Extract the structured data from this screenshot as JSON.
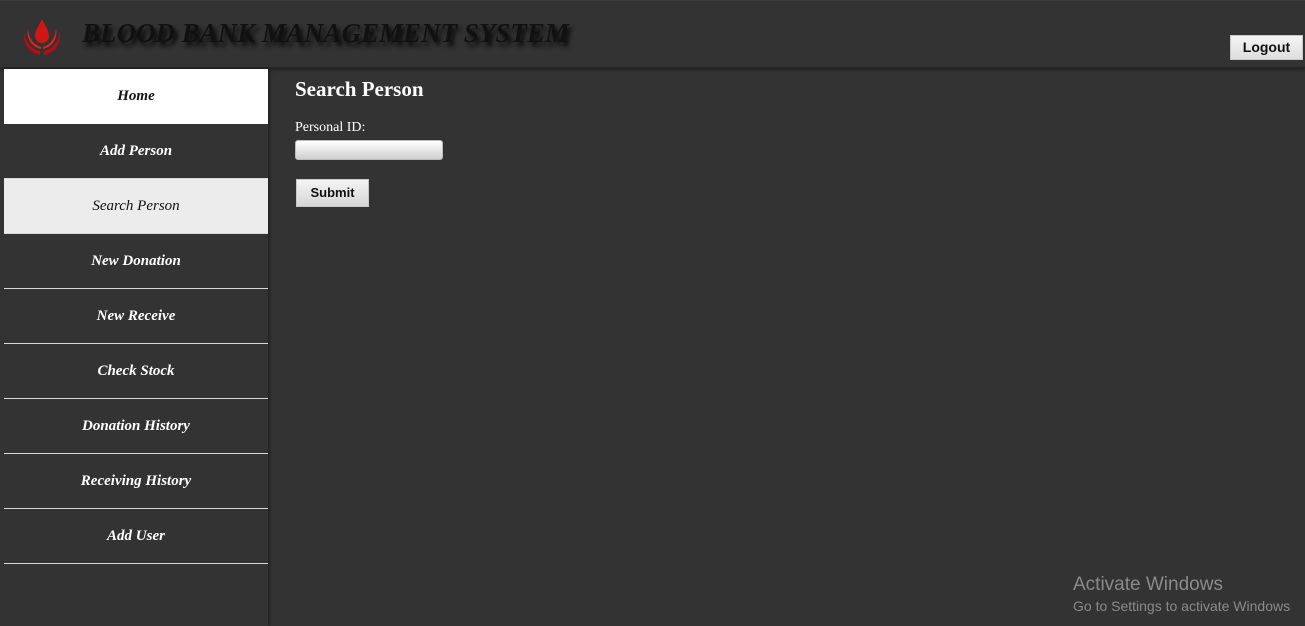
{
  "header": {
    "title": "BLOOD BANK MANAGEMENT SYSTEM",
    "logo_icon": "blood-drop-hands-icon",
    "logout_label": "Logout"
  },
  "sidebar": {
    "items": [
      {
        "label": "Home",
        "state": "home"
      },
      {
        "label": "Add Person",
        "state": "normal"
      },
      {
        "label": "Search Person",
        "state": "active"
      },
      {
        "label": "New Donation",
        "state": "normal"
      },
      {
        "label": "New Receive",
        "state": "normal"
      },
      {
        "label": "Check Stock",
        "state": "normal"
      },
      {
        "label": "Donation History",
        "state": "normal"
      },
      {
        "label": "Receiving History",
        "state": "normal"
      },
      {
        "label": "Add User",
        "state": "normal"
      }
    ]
  },
  "main": {
    "title": "Search Person",
    "form": {
      "personal_id_label": "Personal ID:",
      "personal_id_value": "",
      "submit_label": "Submit"
    }
  },
  "watermark": {
    "title": "Activate Windows",
    "subtitle": "Go to Settings to activate Windows"
  },
  "colors": {
    "background": "#333333",
    "logo_red": "#cc1111",
    "active_nav": "#ececec"
  }
}
